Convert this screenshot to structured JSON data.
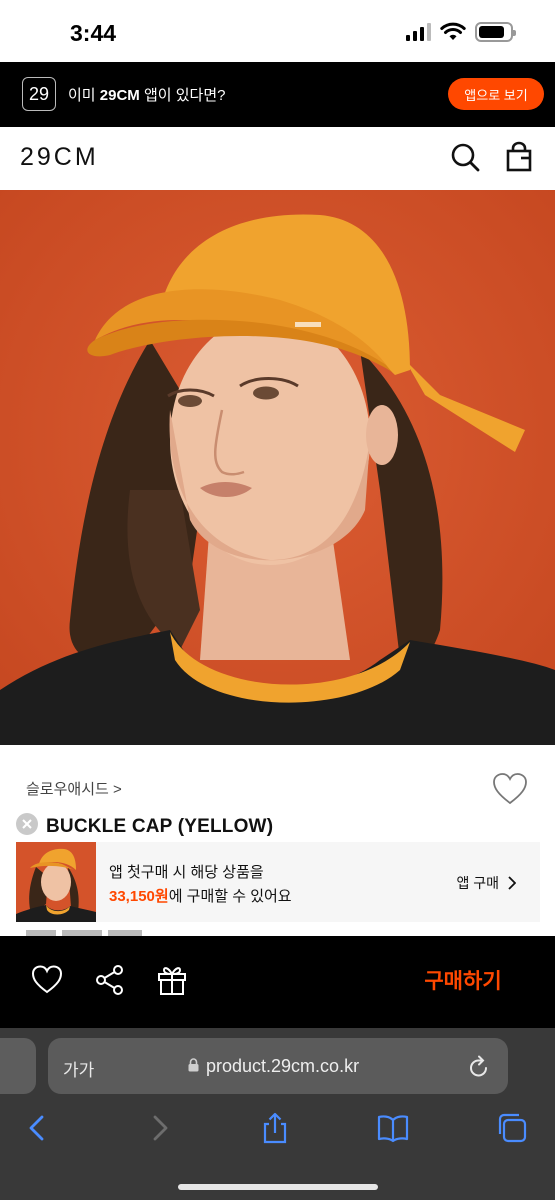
{
  "status_bar": {
    "time": "3:44"
  },
  "app_banner": {
    "logo_text": "29",
    "text_prefix": "이미 ",
    "text_brand": "29CM",
    "text_suffix": " 앱이 있다면?",
    "button_label": "앱으로 보기"
  },
  "header": {
    "logo": "29CM"
  },
  "product": {
    "brand": "슬로우애시드 >",
    "title": "BUCKLE CAP (YELLOW)"
  },
  "promo": {
    "line1": "앱 첫구매 시 해당 상품을",
    "price": "33,150원",
    "line2_suffix": "에 구매할 수 있어요",
    "link_label": "앱 구매"
  },
  "action_bar": {
    "buy_label": "구매하기"
  },
  "safari": {
    "text_size_label": "가가",
    "url": "product.29cm.co.kr"
  },
  "colors": {
    "accent": "#ff4800",
    "backdrop": "#d4532a",
    "cap": "#f0a32e"
  }
}
